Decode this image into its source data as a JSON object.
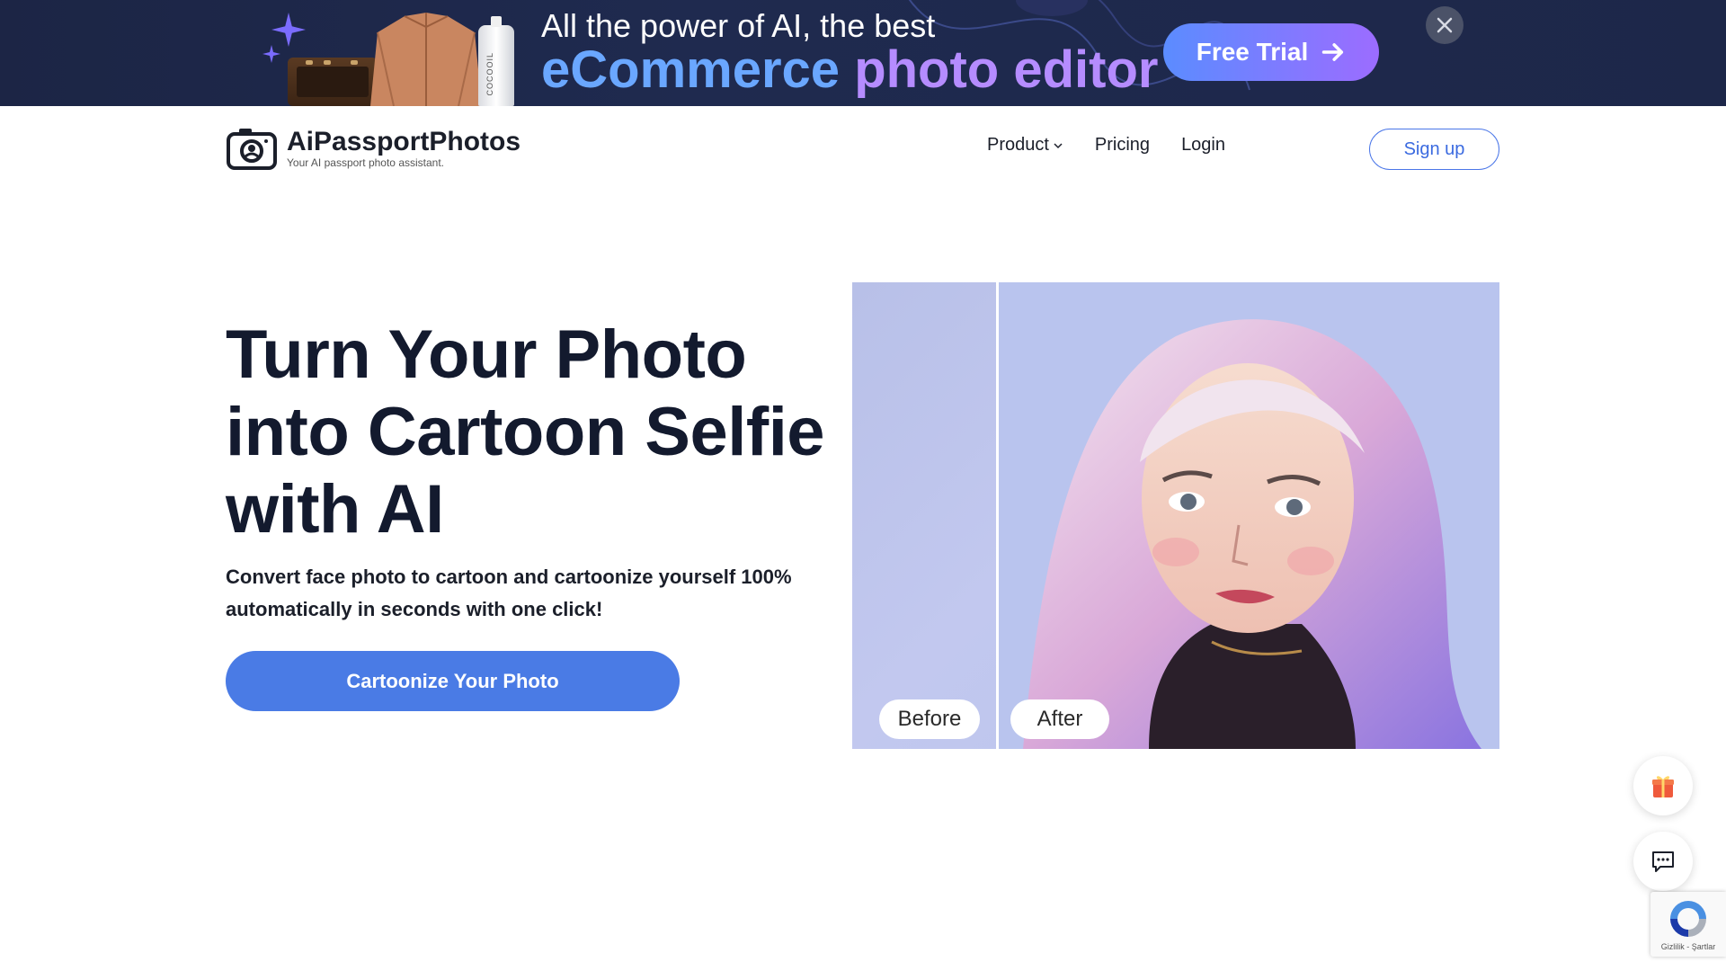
{
  "promo": {
    "line1": "All the power of AI, the best",
    "line2_part1": "eCommerce",
    "line2_part2": "photo editor",
    "trial_label": "Free Trial",
    "bottle_label": "COCOOIL",
    "colors": {
      "background": "#1f2a4f",
      "accent_blue": "#6aa7ff",
      "accent_purple": "#b58cff"
    }
  },
  "header": {
    "brand_name": "AiPassportPhotos",
    "brand_tagline": "Your AI passport photo assistant.",
    "nav": {
      "product": "Product",
      "pricing": "Pricing",
      "login": "Login"
    },
    "signup_label": "Sign up"
  },
  "hero": {
    "title": "Turn Your Photo into Cartoon Selfie with AI",
    "subtitle": "Convert face photo to cartoon and cartoonize yourself 100% automatically in seconds with one click!",
    "cta_label": "Cartoonize Your Photo",
    "accent_color": "#4a7be5"
  },
  "compare": {
    "before_label": "Before",
    "after_label": "After"
  },
  "recaptcha": {
    "text": "Gizlilik - Şartlar"
  },
  "icons": {
    "gift": "gift-icon",
    "chat": "chat-icon",
    "close": "close-icon",
    "arrow": "arrow-right-icon"
  }
}
